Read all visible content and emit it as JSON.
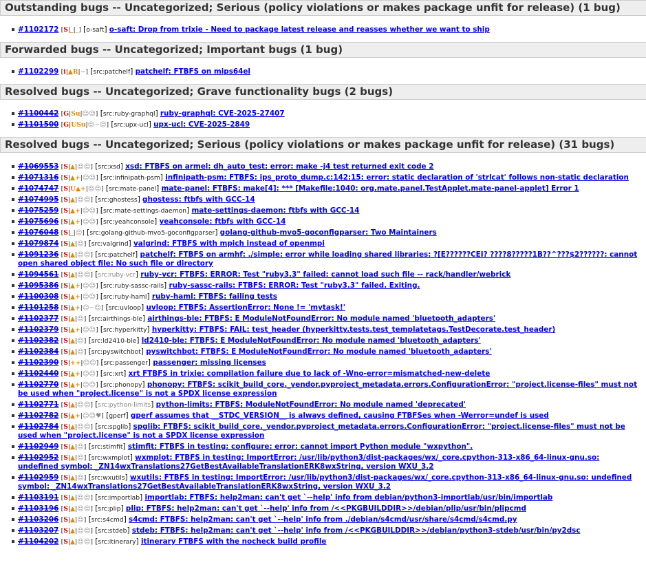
{
  "sections": [
    {
      "heading": "Outstanding bugs -- Uncategorized; Serious (policy violations or makes package unfit for release) (1 bug)",
      "bugs": [
        {
          "num": "#1102172",
          "tags": "S|_|_",
          "pkg": "o-saft",
          "title": "o-saft: Drop from trixie - Need to package latest release and reasses whether we want to ship",
          "done": false
        }
      ]
    },
    {
      "heading": "Forwarded bugs -- Uncategorized; Important bugs (1 bug)",
      "bugs": [
        {
          "num": "#1102299",
          "tags": "i|▲R|~",
          "pkg": "src:patchelf",
          "title": "patchelf: FTBFS on mips64el",
          "done": false
        }
      ]
    },
    {
      "heading": "Resolved bugs -- Uncategorized; Grave functionality bugs (2 bugs)",
      "bugs": [
        {
          "num": "#1100442",
          "tags": "G|Su|☺☺",
          "pkg": "src:ruby-graphql",
          "title": "ruby-graphql: CVE-2025-27407",
          "done": true
        },
        {
          "num": "#1101500",
          "tags": "G|USu|☺~☺",
          "pkg": "src:upx-ucl",
          "title": "upx-ucl: CVE-2025-2849",
          "done": true
        }
      ]
    },
    {
      "heading": "Resolved bugs -- Uncategorized; Serious (policy violations or makes package unfit for release) (31 bugs)",
      "bugs": [
        {
          "num": "#1069553",
          "tags": "S|▲|☺☺",
          "pkg": "src:xsd",
          "title": "xsd: FTBFS on armel: dh_auto_test: error: make -j4 test returned exit code 2",
          "done": true
        },
        {
          "num": "#1071316",
          "tags": "S|▲+|☺☺",
          "pkg": "src:infinipath-psm",
          "title": "infinipath-psm: FTBFS: ips_proto_dump.c:142:15: error: static declaration of 'strlcat' follows non-static declaration",
          "done": true
        },
        {
          "num": "#1074747",
          "tags": "S|U▲+|☺☺",
          "pkg": "src:mate-panel",
          "title": "mate-panel: FTBFS: make[4]: *** [Makefile:1040: org.mate.panel.TestApplet.mate-panel-applet] Error 1",
          "done": true
        },
        {
          "num": "#1074995",
          "tags": "S|▲|☺☺",
          "pkg": "src:ghostess",
          "title": "ghostess: ftbfs with GCC-14",
          "done": true
        },
        {
          "num": "#1075259",
          "tags": "S|▲+|☺☺",
          "pkg": "src:mate-settings-daemon",
          "title": "mate-settings-daemon: ftbfs with GCC-14",
          "done": true
        },
        {
          "num": "#1075696",
          "tags": "S|▲+|☺☺",
          "pkg": "src:yeahconsole",
          "title": "yeahconsole: ftbfs with GCC-14",
          "done": true
        },
        {
          "num": "#1076048",
          "tags": "S|_|☺",
          "pkg": "src:golang-github-mvo5-goconfigparser",
          "title": "golang-github-mvo5-goconfigparser: Two Maintainers",
          "done": true
        },
        {
          "num": "#1079874",
          "tags": "S|▲|☺",
          "pkg": "src:valgrind",
          "title": "valgrind: FTBFS with mpich instead of openmpi",
          "done": true
        },
        {
          "num": "#1091236",
          "tags": "S|▲|☺☺",
          "pkg": "src:patchelf",
          "title": "patchelf: FTBFS on armhf: ./simple: error while loading shared libraries: ?[E??????CEI? ????8?????1B??^???$2??????: cannot open shared object file: No such file or directory",
          "done": true
        },
        {
          "num": "#1094561",
          "tags": "S|▲|☺☺",
          "pkg": "src:ruby-vcr",
          "pkggrey": true,
          "title": "ruby-vcr: FTBFS: ERROR: Test \"ruby3.3\" failed: cannot load such file -- rack/handler/webrick",
          "done": true
        },
        {
          "num": "#1095386",
          "tags": "S|▲+|☺☺",
          "pkg": "src:ruby-sassc-rails",
          "title": "ruby-sassc-rails: FTBFS: ERROR: Test \"ruby3.3\" failed. Exiting.",
          "done": true
        },
        {
          "num": "#1100308",
          "tags": "S|▲+|☺☺",
          "pkg": "src:ruby-haml",
          "title": "ruby-haml: FTBFS: failing tests",
          "done": true
        },
        {
          "num": "#1101258",
          "tags": "S|▲+|☺~☺",
          "pkg": "src:uvloop",
          "title": "uvloop: FTBFS: AssertionError: None != 'mytask!'",
          "done": true
        },
        {
          "num": "#1102377",
          "tags": "S|▲|☺",
          "pkg": "src:airthings-ble",
          "title": "airthings-ble: FTBFS: E ModuleNotFoundError: No module named 'bluetooth_adapters'",
          "done": true
        },
        {
          "num": "#1102379",
          "tags": "S|▲+|☺☺",
          "pkg": "src:hyperkitty",
          "title": "hyperkitty: FTBFS: FAIL: test_header (hyperkitty.tests.test_templatetags.TestDecorate.test_header)",
          "done": true
        },
        {
          "num": "#1102382",
          "tags": "S|▲|☺",
          "pkg": "src:ld2410-ble",
          "title": "ld2410-ble: FTBFS: E ModuleNotFoundError: No module named 'bluetooth_adapters'",
          "done": true
        },
        {
          "num": "#1102384",
          "tags": "S|▲|☺",
          "pkg": "src:pyswitchbot",
          "title": "pyswitchbot: FTBFS: E ModuleNotFoundError: No module named 'bluetooth_adapters'",
          "done": true
        },
        {
          "num": "#1102390",
          "tags": "S|++|☺☺",
          "pkg": "src:passenger",
          "title": "passenger: missing licenses",
          "done": true
        },
        {
          "num": "#1102440",
          "tags": "S|▲+|☺☺",
          "pkg": "src:xrt",
          "title": "xrt FTBFS in trixie: compilation failure due to lack of -Wno-error=mismatched-new-delete",
          "done": true
        },
        {
          "num": "#1102770",
          "tags": "S|▲+|☺☺",
          "pkg": "src:phonopy",
          "title": "phonopy: FTBFS: scikit_build_core._vendor.pyproject_metadata.errors.ConfigurationError: \"project.license-files\" must not be used when \"project.license\" is not a SPDX license expression",
          "done": true
        },
        {
          "num": "#1102771",
          "tags": "S|▲|☺☺",
          "pkg": "src:python-limits",
          "pkggrey": true,
          "title": "python-limits: FTBFS: ModuleNotFoundError: No module named 'deprecated'",
          "done": true
        },
        {
          "num": "#1102782",
          "tags": "S|▲+|☺☺♥",
          "pkg": "gperf",
          "title": "gperf assumes that __STDC_VERSION__ is always defined, causing FTBFSes when -Werror=undef is used",
          "done": true
        },
        {
          "num": "#1102784",
          "tags": "S|▲|☺☺",
          "pkg": "src:spglib",
          "title": "spglib: FTBFS: scikit_build_core._vendor.pyproject_metadata.errors.ConfigurationError: \"project.license-files\" must not be used when \"project.license\" is not a SPDX license expression",
          "done": true
        },
        {
          "num": "#1102949",
          "tags": "S|▲|☺",
          "pkg": "src:stimfit",
          "title": "stimfit: FTBFS in testing: configure: error: cannot import Python module \"wxpython\".",
          "done": true
        },
        {
          "num": "#1102952",
          "tags": "S|▲|☺",
          "pkg": "src:wxmplot",
          "title": "wxmplot: FTBFS in testing: ImportError: /usr/lib/python3/dist-packages/wx/_core.cpython-313-x86_64-linux-gnu.so: undefined symbol: _ZN14wxTranslations27GetBestAvailableTranslationERK8wxString, version WXU_3.2",
          "done": true
        },
        {
          "num": "#1102959",
          "tags": "S|▲|☺",
          "pkg": "src:wxutils",
          "title": "wxutils: FTBFS in testing: ImportError: /usr/lib/python3/dist-packages/wx/_core.cpython-313-x86_64-linux-gnu.so: undefined symbol: _ZN14wxTranslations27GetBestAvailableTranslationERK8wxString, version WXU_3.2",
          "done": true
        },
        {
          "num": "#1103191",
          "tags": "S|▲|☺☺",
          "pkg": "src:importlab",
          "title": "importlab: FTBFS: help2man: can't get `--help' info from debian/python3-importlab/usr/bin/importlab",
          "done": true
        },
        {
          "num": "#1103196",
          "tags": "S|▲|☺☺",
          "pkg": "src:plip",
          "title": "plip: FTBFS: help2man: can't get `--help' info from /<<PKGBUILDDIR>>/debian/plip/usr/bin/plipcmd",
          "done": true
        },
        {
          "num": "#1103206",
          "tags": "S|▲|☺",
          "pkg": "src:s4cmd",
          "title": "s4cmd: FTBFS: help2man: can't get `--help' info from ./debian/s4cmd/usr/share/s4cmd/s4cmd.py",
          "done": true
        },
        {
          "num": "#1103207",
          "tags": "S|▲|☺☺",
          "pkg": "src:stdeb",
          "title": "stdeb: FTBFS: help2man: can't get `--help' info from /<<PKGBUILDDIR>>/debian/python3-stdeb/usr/bin/py2dsc",
          "done": true
        },
        {
          "num": "#1104202",
          "tags": "S|▲|☺☺",
          "pkg": "src:itinerary",
          "title": "itinerary FTBFS with the nocheck build profile",
          "done": true
        }
      ]
    }
  ],
  "colors": {
    "link": "#0000ee",
    "severity_red": "#cc0000",
    "tag_blue": "#1a4fa0",
    "tag_orange": "#dd8800",
    "heading_bg": "#eeeeee"
  }
}
